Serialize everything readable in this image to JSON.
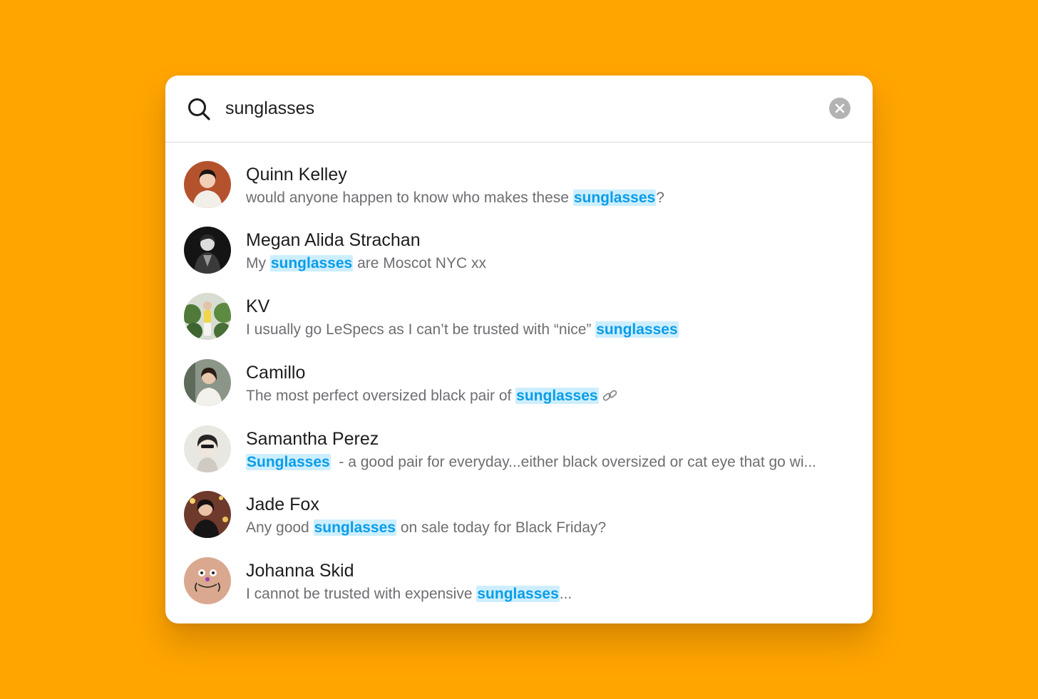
{
  "search": {
    "query": "sunglasses",
    "icon": "search-icon",
    "clear_icon": "close-icon"
  },
  "colors": {
    "background": "#FFA500",
    "highlight_bg": "#cdeefe",
    "highlight_text": "#0a9de8"
  },
  "results": [
    {
      "name": "Quinn Kelley",
      "snippet": {
        "before": "would anyone happen to know who makes these ",
        "match": "sunglasses",
        "after": "?"
      }
    },
    {
      "name": "Megan Alida Strachan",
      "snippet": {
        "before": "My ",
        "match": "sunglasses",
        "after": " are Moscot NYC xx"
      }
    },
    {
      "name": "KV",
      "snippet": {
        "before": "I usually go LeSpecs as I can’t be trusted with “nice” ",
        "match": "sunglasses",
        "after": ""
      }
    },
    {
      "name": "Camillo",
      "snippet": {
        "before": "The most perfect oversized black pair of ",
        "match": "sunglasses",
        "after": ""
      },
      "trailing_icon": "link-icon"
    },
    {
      "name": "Samantha Perez",
      "snippet": {
        "before": "",
        "match": "Sunglasses",
        "after": "  - a good pair for everyday...either black oversized or cat eye that go wi..."
      }
    },
    {
      "name": "Jade Fox",
      "snippet": {
        "before": "Any good ",
        "match": "sunglasses",
        "after": " on sale today for Black Friday?"
      }
    },
    {
      "name": "Johanna Skid",
      "snippet": {
        "before": "I cannot be trusted with expensive ",
        "match": "sunglasses",
        "after": "..."
      }
    }
  ]
}
